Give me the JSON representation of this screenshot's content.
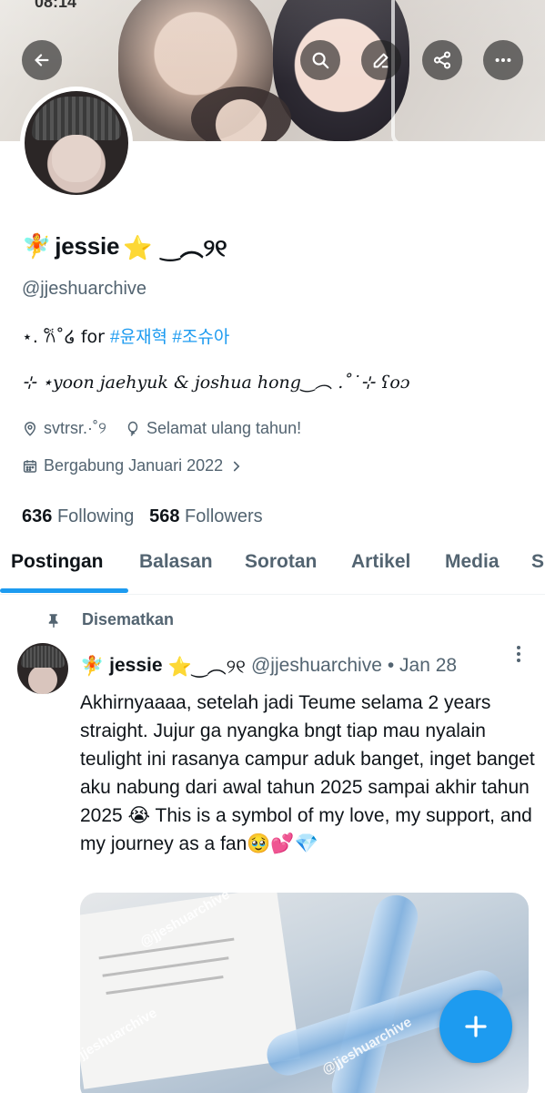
{
  "status": {
    "time": "08:14"
  },
  "header": {
    "back_icon": "arrow-left-icon",
    "search_icon": "search-icon",
    "edit_icon": "pencil-icon",
    "share_icon": "share-icon",
    "more_icon": "more-horizontal-icon"
  },
  "profile": {
    "name_prefix": "🧚",
    "name": "jessie",
    "name_suffix": "⭐️ ‿︵୨୧",
    "handle": "@jjeshuarchive",
    "bio_line1_prefix": "⋆. 𐙚˚໒ for ",
    "bio_tag1": "#윤재혁",
    "bio_tag2": "#조슈아",
    "bio_line2": "⊹ ⋆yoon jaehyuk & joshua hong‿︵ .˚˙⊹ ʕoɔ",
    "location": "svtrsr.·˚୨",
    "birthday": "Selamat ulang tahun!",
    "joined": "Bergabung Januari 2022",
    "following_count": "636",
    "following_label": "Following",
    "followers_count": "568",
    "followers_label": "Followers"
  },
  "tabs": [
    {
      "label": "Postingan"
    },
    {
      "label": "Balasan"
    },
    {
      "label": "Sorotan"
    },
    {
      "label": "Artikel"
    },
    {
      "label": "Media"
    },
    {
      "label": "S"
    }
  ],
  "post": {
    "pinned_label": "Disematkan",
    "author_prefix": "🧚",
    "author": "jessie",
    "author_suffix": "⭐️‿︵୨୧",
    "handle": "@jjeshuarchive",
    "date": "• Jan 28",
    "text": "Akhirnyaaaa, setelah jadi Teume selama 2 years straight. Jujur ga nyangka bngt tiap mau nyalain teulight ini rasanya campur aduk banget, inget banget aku nabung dari awal tahun 2025 sampai akhir tahun 2025 😭 This is a symbol of my love, my support, and my journey as a fan🥹💕💎",
    "watermark": "@jjeshuarchive"
  },
  "colors": {
    "accent": "#1d9bf0",
    "muted": "#536471",
    "text": "#0f1419"
  }
}
